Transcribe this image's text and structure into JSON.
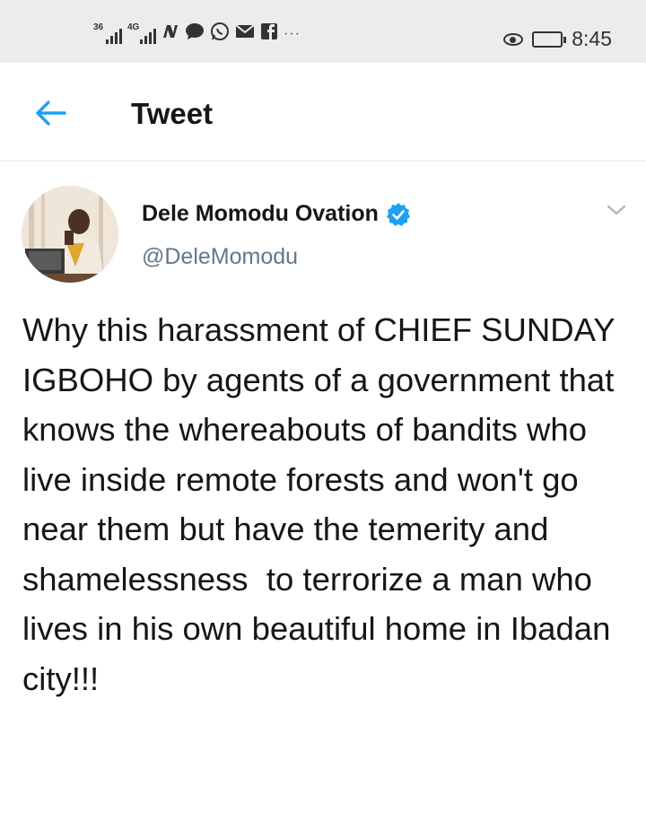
{
  "status_bar": {
    "sim1_network": "36",
    "sim2_network": "4G",
    "notification_icons": [
      "n-icon",
      "chat-bubble-icon",
      "whatsapp-icon",
      "mail-icon",
      "facebook-icon"
    ],
    "more": "···",
    "time": "8:45"
  },
  "header": {
    "title": "Tweet",
    "back_icon": "arrow-left-icon"
  },
  "tweet": {
    "author_name": "Dele Momodu Ovation",
    "handle": "@DeleMomodu",
    "text": "Why this harassment of CHIEF SUNDAY IGBOHO by agents of a government that knows the whereabouts of bandits who live inside remote forests and won't go near them but have the temerity and shamelessness  to terrorize a man who lives in his own beautiful home in Ibadan city!!!"
  },
  "colors": {
    "accent": "#1da1f2",
    "status_bar_bg": "#ececec",
    "secondary_text": "#657786"
  }
}
